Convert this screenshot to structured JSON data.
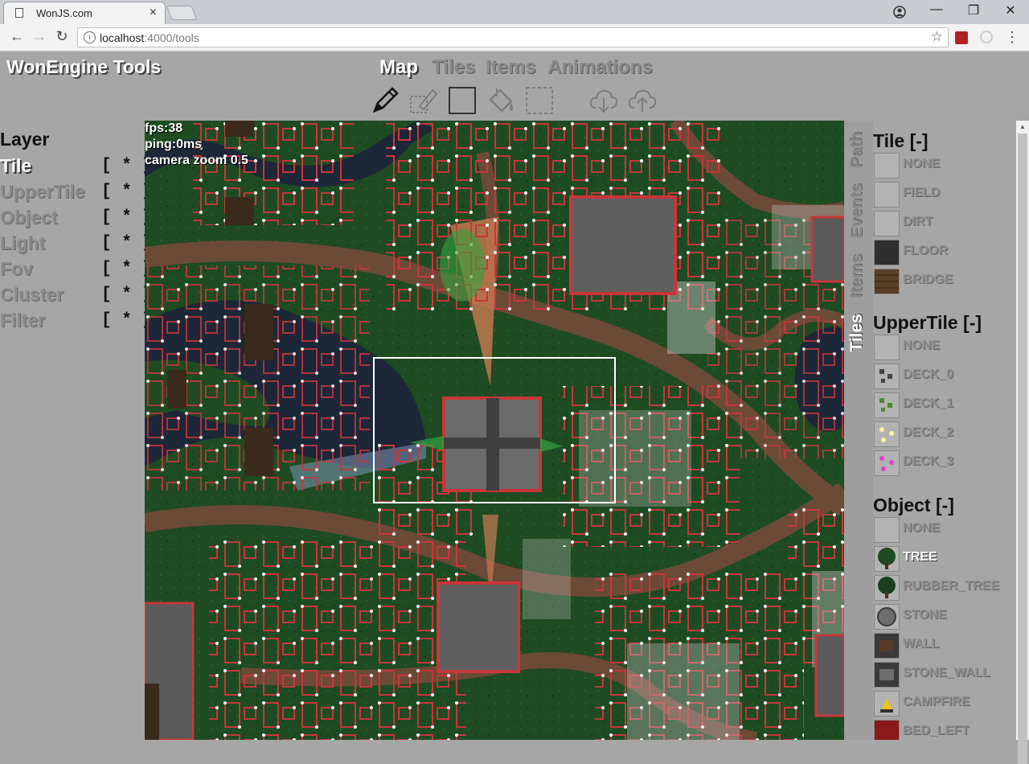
{
  "browser": {
    "tab_title": "WonJS.com",
    "tab_close": "×",
    "url_host": "localhost",
    "url_rest": ":4000/tools",
    "controls": {
      "minimize": "—",
      "maximize": "❐",
      "close": "✕",
      "menu": "⋮"
    },
    "nav": {
      "back": "←",
      "forward": "→",
      "reload": "↻"
    },
    "info_icon": "i",
    "star_icon": "☆"
  },
  "app": {
    "brand": "WonEngine Tools",
    "nav": [
      "Map",
      "Tiles",
      "Items",
      "Animations"
    ],
    "active_nav": "Map"
  },
  "tools": [
    "pencil-icon",
    "stamp-icon",
    "rectangle-icon",
    "fill-bucket-icon",
    "selection-icon",
    "cloud-download-icon",
    "cloud-upload-icon"
  ],
  "layers": {
    "title": "Layer",
    "items": [
      {
        "name": "Tile",
        "vis": "[ * ]",
        "active": true
      },
      {
        "name": "UpperTile",
        "vis": "[ * ]"
      },
      {
        "name": "Object",
        "vis": "[ * ]"
      },
      {
        "name": "Light",
        "vis": "[ * ]"
      },
      {
        "name": "Fov",
        "vis": "[ * ]"
      },
      {
        "name": "Cluster",
        "vis": "[ * ]"
      },
      {
        "name": "Filter",
        "vis": "[ * ]"
      }
    ]
  },
  "map": {
    "fps": "fps:38",
    "ping": "ping:0ms",
    "camera": "camera zoom 0.5"
  },
  "side_tabs": [
    "Path",
    "Events",
    "Items",
    "Tiles"
  ],
  "palette": {
    "tile": {
      "title": "Tile [-]",
      "items": [
        "NONE",
        "FIELD",
        "DIRT",
        "FLOOR",
        "BRIDGE"
      ]
    },
    "upper_tile": {
      "title": "UpperTile [-]",
      "items": [
        "NONE",
        "DECK_0",
        "DECK_1",
        "DECK_2",
        "DECK_3"
      ]
    },
    "object": {
      "title": "Object [-]",
      "items": [
        "NONE",
        "TREE",
        "RUBBER_TREE",
        "STONE",
        "WALL",
        "STONE_WALL",
        "CAMPFIRE",
        "BED_LEFT"
      ],
      "selected": "TREE"
    }
  },
  "colors": {
    "grass": "#1d4a21",
    "water": "#1c2738",
    "dirt": "#6b4a36",
    "wall": "#c8363a",
    "floor": "#6a6a6a"
  }
}
